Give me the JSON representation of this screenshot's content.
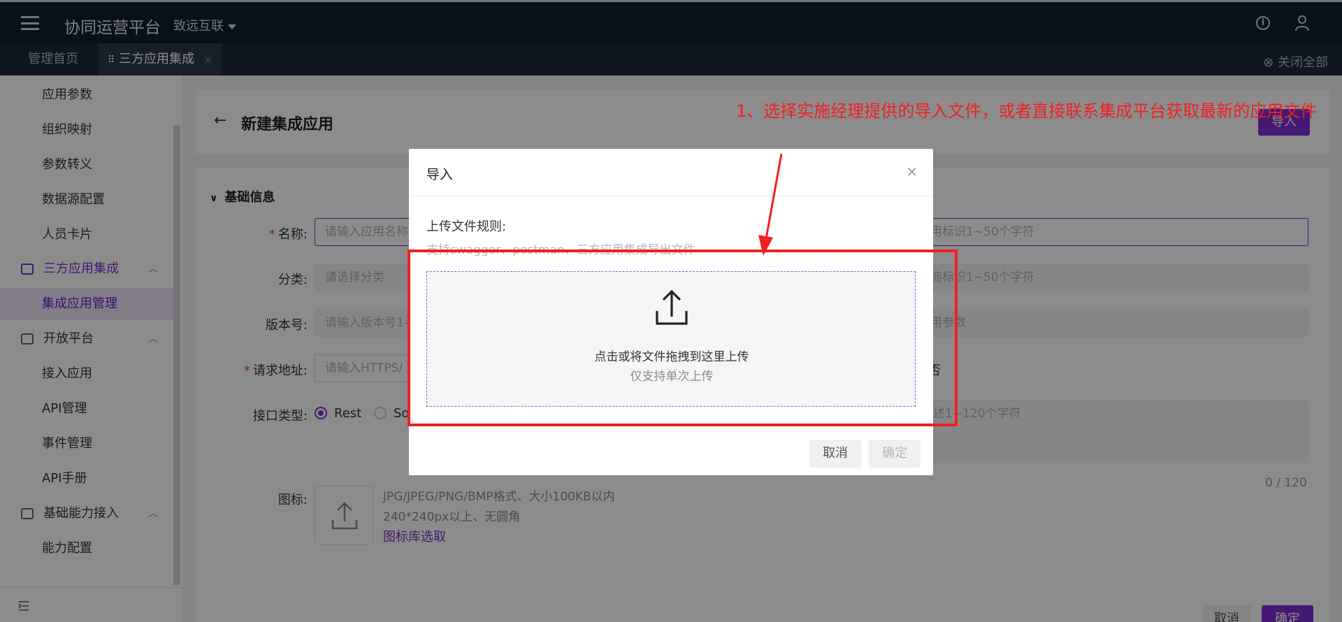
{
  "topbar": {
    "app_title": "协同运营平台",
    "org": "致远互联"
  },
  "tabs": [
    {
      "label": "管理首页"
    },
    {
      "label": "三方应用集成",
      "close": "×"
    }
  ],
  "close_all": "关闭全部",
  "sidebar": {
    "items": [
      {
        "label": "应用参数",
        "type": "sub"
      },
      {
        "label": "组织映射",
        "type": "sub"
      },
      {
        "label": "参数转义",
        "type": "sub"
      },
      {
        "label": "数据源配置",
        "type": "sub"
      },
      {
        "label": "人员卡片",
        "type": "sub"
      },
      {
        "label": "三方应用集成",
        "type": "group",
        "icon": "integration-icon"
      },
      {
        "label": "集成应用管理",
        "type": "sub",
        "selected": true
      },
      {
        "label": "开放平台",
        "type": "group",
        "icon": "monitor-icon"
      },
      {
        "label": "接入应用",
        "type": "sub"
      },
      {
        "label": "API管理",
        "type": "sub"
      },
      {
        "label": "事件管理",
        "type": "sub"
      },
      {
        "label": "API手册",
        "type": "sub"
      },
      {
        "label": "基础能力接入",
        "type": "group",
        "icon": "capability-icon"
      },
      {
        "label": "能力配置",
        "type": "sub"
      }
    ]
  },
  "page": {
    "title": "新建集成应用",
    "import_label": "导入",
    "section": "基础信息",
    "fields": {
      "name_label": "名称:",
      "name_placeholder": "请输入应用名称",
      "id_placeholder": "用标识1~50个字符",
      "category_label": "分类:",
      "category_placeholder": "请选择分类",
      "vendor_placeholder": "商标识1~50个字符",
      "version_label": "版本号:",
      "version_placeholder": "请输入版本号1-",
      "param_placeholder": "用参数",
      "url_label": "请求地址:",
      "url_placeholder": "请输入HTTPS/",
      "no_label": "否",
      "api_type_label": "接口类型:",
      "rest_label": "Rest",
      "soap_label": "So",
      "desc_placeholder": "述1~120个字符",
      "desc_count": "0 / 120",
      "icon_label": "图标:",
      "icon_hint1": "JPG/JPEG/PNG/BMP格式、大小100KB以内",
      "icon_hint2": "240*240px以上、无圆角",
      "icon_link": "图标库选取"
    },
    "cancel": "取消",
    "confirm": "确定"
  },
  "dialog": {
    "title": "导入",
    "close": "×",
    "rule_label": "上传文件规则:",
    "rule_text": "支持swagger、postman、三方应用集成导出文件",
    "drop_text": "点击或将文件拖拽到这里上传",
    "drop_sub": "仅支持单次上传",
    "cancel": "取消",
    "confirm": "确定"
  },
  "annotation": {
    "text": "1、选择实施经理提供的导入文件，或者直接联系集成平台获取最新的应用文件"
  },
  "colors": {
    "accent": "#7b2fd1",
    "topbar": "#0f1f2f",
    "annotation": "#f02020"
  }
}
